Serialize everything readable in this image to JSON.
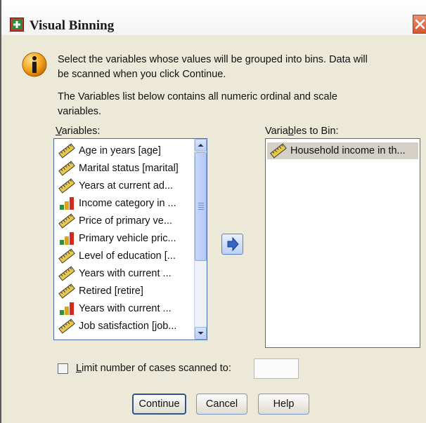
{
  "dialog": {
    "title": "Visual Binning",
    "close_icon": "close-icon"
  },
  "info": {
    "icon": "info-icon",
    "line1": "Select the variables whose values will be grouped into bins. Data will",
    "line2": "be scanned when you click Continue.",
    "line3": "The Variables list below contains all numeric ordinal and scale",
    "line4": "variables."
  },
  "variables": {
    "label": "Variables:",
    "items": [
      {
        "label": "Age in years [age]",
        "icon": "scale-ruler-icon"
      },
      {
        "label": "Marital status [marital]",
        "icon": "scale-ruler-icon"
      },
      {
        "label": "Years at current ad...",
        "icon": "scale-ruler-icon"
      },
      {
        "label": "Income category in ...",
        "icon": "ordinal-bars-icon"
      },
      {
        "label": "Price of primary ve...",
        "icon": "scale-ruler-icon"
      },
      {
        "label": "Primary vehicle pric...",
        "icon": "ordinal-bars-icon"
      },
      {
        "label": "Level of education [...",
        "icon": "scale-ruler-icon"
      },
      {
        "label": "Years with current ...",
        "icon": "scale-ruler-icon"
      },
      {
        "label": "Retired [retire]",
        "icon": "scale-ruler-icon"
      },
      {
        "label": "Years with current ...",
        "icon": "ordinal-bars-icon"
      },
      {
        "label": "Job satisfaction [job...",
        "icon": "scale-ruler-icon"
      }
    ]
  },
  "bin": {
    "label": "Variables to Bin:",
    "items": [
      {
        "label": "Household income in th...",
        "icon": "scale-ruler-icon"
      }
    ]
  },
  "move_button": {
    "icon": "arrow-right-icon"
  },
  "limit": {
    "checkbox_label": "Limit number of cases scanned to:",
    "checked": false,
    "value": ""
  },
  "buttons": {
    "continue": "Continue",
    "cancel": "Cancel",
    "help": "Help"
  },
  "colors": {
    "dialog_bg": "#ece9d8",
    "selection": "#d4d0c8",
    "list_border": "#4a6aa6",
    "close_red": "#d9552d"
  }
}
